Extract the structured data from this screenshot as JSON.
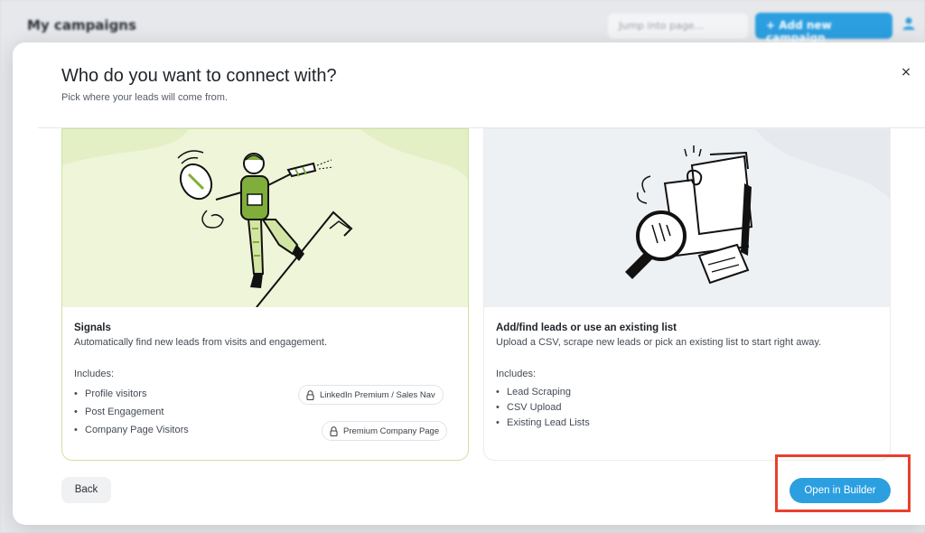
{
  "background": {
    "title": "My campaigns",
    "search_placeholder": "Jump into page...",
    "add_button": "+ Add new campaign",
    "user_icon": "user-icon"
  },
  "modal": {
    "title": "Who do you want to connect with?",
    "subtitle": "Pick where your leads will come from.",
    "close_label": "×"
  },
  "cards": [
    {
      "title": "Signals",
      "description": "Automatically find new leads from visits and engagement.",
      "includes_label": "Includes:",
      "items": [
        "Profile visitors",
        "Post Engagement",
        "Company Page Visitors"
      ],
      "badges": [
        "LinkedIn Premium / Sales Nav",
        "Premium Company Page"
      ],
      "badge_icon": "lock-icon",
      "illustration": "mountain-climber-illustration",
      "selected": true
    },
    {
      "title": "Add/find leads or use an existing list",
      "description": "Upload a CSV, scrape new leads or pick an existing list to start right away.",
      "includes_label": "Includes:",
      "items": [
        "Lead Scraping",
        "CSV Upload",
        "Existing Lead Lists"
      ],
      "illustration": "magnifier-documents-illustration",
      "selected": false
    }
  ],
  "footer": {
    "back_label": "Back",
    "open_label": "Open in Builder"
  },
  "colors": {
    "accent": "#2c9fe0",
    "selected_border": "#cfe3a0",
    "selected_bg": "#eef5d8",
    "highlight": "#e8412c"
  }
}
